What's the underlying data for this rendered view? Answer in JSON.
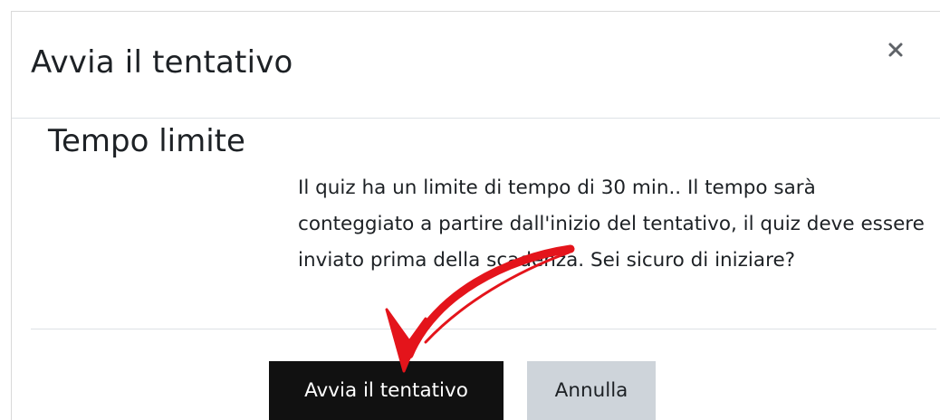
{
  "dialog": {
    "title": "Avvia il tentativo",
    "close_icon": "close-icon"
  },
  "section": {
    "title": "Tempo limite",
    "message": "Il quiz ha un limite di tempo di 30 min.. Il tempo sarà conteggiato a partire dall'inizio del tentativo, il quiz deve essere inviato prima della scadenza. Sei sicuro di iniziare?"
  },
  "actions": {
    "start_label": "Avvia il tentativo",
    "cancel_label": "Annulla"
  },
  "annotation": {
    "arrow_icon": "red-arrow-icon",
    "arrow_color": "#e4141b"
  },
  "colors": {
    "primary_button": "#111111",
    "secondary_button": "#ced4da",
    "text": "#1d2125"
  }
}
